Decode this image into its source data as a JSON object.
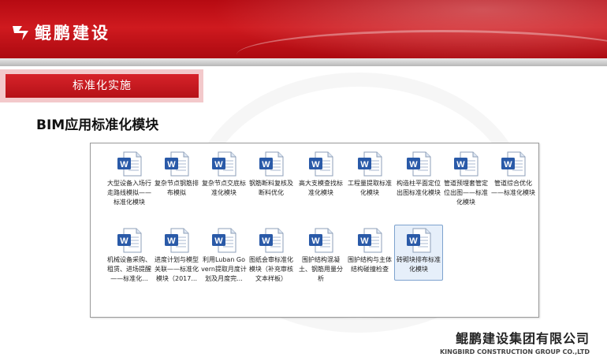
{
  "header": {
    "logo_text": "鲲鹏建设",
    "brand_color": "#c8141b",
    "logo_icon": "kunpeng-logo-icon"
  },
  "section_tab": {
    "label": "标准化实施"
  },
  "heading": "BIM应用标准化模块",
  "explorer": {
    "file_icon": "word-document-icon",
    "selected_index": 17,
    "files": [
      {
        "name": "大型设备入场行走路线模拟——标准化模块"
      },
      {
        "name": "复杂节点钢筋排布模拟"
      },
      {
        "name": "复杂节点交底标准化模块"
      },
      {
        "name": "钢筋断料复核及断料优化"
      },
      {
        "name": "高大支模查找标准化模块"
      },
      {
        "name": "工程量提取标准化模块"
      },
      {
        "name": "构造柱平面定位出图标准化模块"
      },
      {
        "name": "管道预埋套管定位出图——标准化模块"
      },
      {
        "name": "管道综合优化——标准化模块"
      },
      {
        "name": "机械设备采购、租赁、进场提醒——标准化..."
      },
      {
        "name": "进度计划与模型关联——标准化模块（2017..."
      },
      {
        "name": "利用Luban Govern提取月度计划及月度完..."
      },
      {
        "name": "图纸会审标准化模块（补充审核文本样板）"
      },
      {
        "name": "围护结构混凝土、钢筋用量分析"
      },
      {
        "name": "围护结构与主体结构碰撞检查"
      },
      {
        "name": "砖砌块排布标准化模块"
      }
    ]
  },
  "footer": {
    "company_name": "鲲鹏建设集团有限公司",
    "company_name_en": "KINGBIRD CONSTRUCTION GROUP CO.,LTD"
  }
}
